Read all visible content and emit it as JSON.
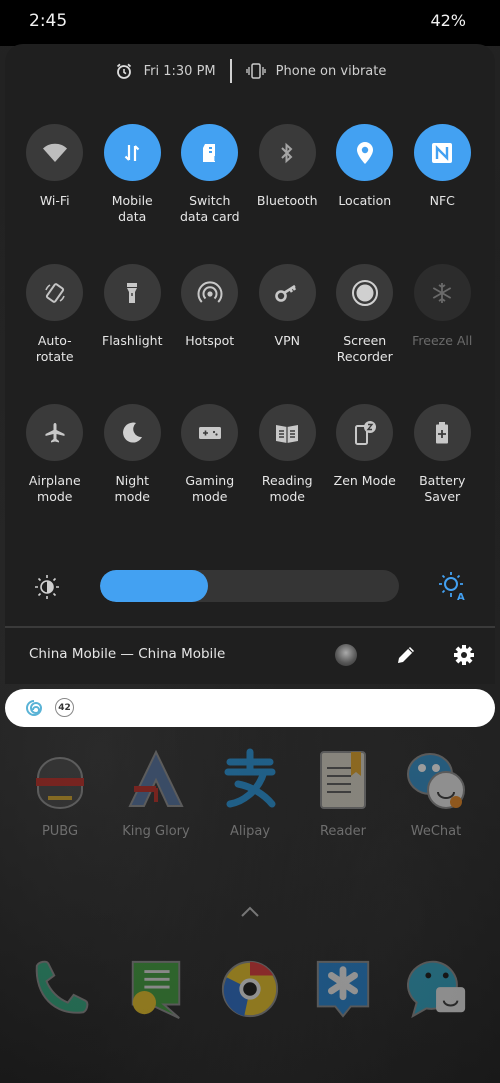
{
  "status_bar": {
    "time": "2:45",
    "battery": "42%"
  },
  "quick_settings": {
    "alarm_icon": "alarm-clock-icon",
    "alarm_text": "Fri 1:30 PM",
    "ringer_icon": "vibrate-icon",
    "ringer_text": "Phone on vibrate",
    "tiles": [
      {
        "label": "Wi-Fi",
        "icon": "wifi-icon",
        "state": "off"
      },
      {
        "label": "Mobile\ndata",
        "icon": "mobile-data-icon",
        "state": "on"
      },
      {
        "label": "Switch\ndata card",
        "icon": "sim-card-icon",
        "state": "on"
      },
      {
        "label": "Bluetooth",
        "icon": "bluetooth-icon",
        "state": "off"
      },
      {
        "label": "Location",
        "icon": "location-pin-icon",
        "state": "on"
      },
      {
        "label": "NFC",
        "icon": "nfc-icon",
        "state": "on"
      },
      {
        "label": "Auto-\nrotate",
        "icon": "auto-rotate-icon",
        "state": "off"
      },
      {
        "label": "Flashlight",
        "icon": "flashlight-icon",
        "state": "off"
      },
      {
        "label": "Hotspot",
        "icon": "hotspot-icon",
        "state": "off"
      },
      {
        "label": "VPN",
        "icon": "key-icon",
        "state": "off"
      },
      {
        "label": "Screen\nRecorder",
        "icon": "record-icon",
        "state": "off"
      },
      {
        "label": "Freeze All",
        "icon": "snowflake-icon",
        "state": "disabled"
      },
      {
        "label": "Airplane\nmode",
        "icon": "airplane-icon",
        "state": "off"
      },
      {
        "label": "Night\nmode",
        "icon": "moon-icon",
        "state": "off"
      },
      {
        "label": "Gaming\nmode",
        "icon": "gamepad-icon",
        "state": "off"
      },
      {
        "label": "Reading\nmode",
        "icon": "book-icon",
        "state": "off"
      },
      {
        "label": "Zen Mode",
        "icon": "zen-mode-icon",
        "state": "off"
      },
      {
        "label": "Battery\nSaver",
        "icon": "battery-plus-icon",
        "state": "off"
      }
    ],
    "brightness": {
      "level_percent": 36,
      "low_icon": "brightness-low-icon",
      "auto_icon": "auto-brightness-icon"
    },
    "carrier": "China Mobile — China Mobile",
    "footer_icons": [
      "user-avatar",
      "edit-pencil-icon",
      "settings-gear-icon"
    ]
  },
  "notification": {
    "app_icon": "app-swirl-icon",
    "badge_count": "42"
  },
  "home": {
    "apps": [
      {
        "label": "PUBG",
        "icon": "pubg-icon"
      },
      {
        "label": "King Glory",
        "icon": "king-glory-icon"
      },
      {
        "label": "Alipay",
        "icon": "alipay-icon"
      },
      {
        "label": "Reader",
        "icon": "reader-icon"
      },
      {
        "label": "WeChat",
        "icon": "wechat-icon"
      }
    ],
    "dock": [
      {
        "icon": "phone-icon"
      },
      {
        "icon": "messages-icon"
      },
      {
        "icon": "browser-icon"
      },
      {
        "icon": "starred-app-icon"
      },
      {
        "icon": "chat-app-icon"
      }
    ],
    "swipe_up_icon": "chevron-up-icon"
  },
  "colors": {
    "accent": "#43a1f2",
    "tile_off": "#3a3a3a",
    "panel": "#1f1f1f"
  }
}
